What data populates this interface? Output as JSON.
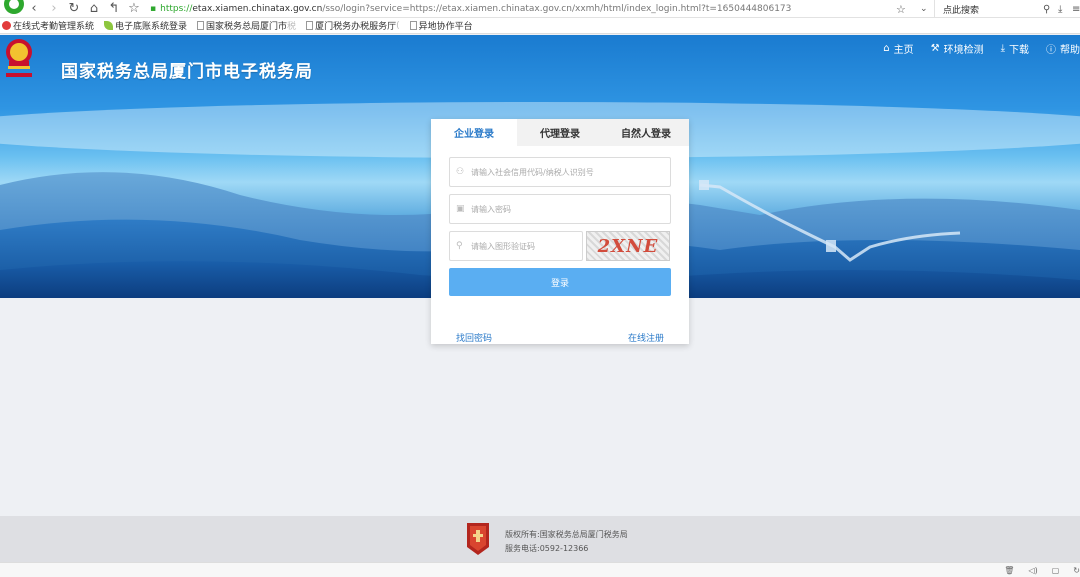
{
  "browser": {
    "url_prefix": "https://",
    "url_host": "etax.xiamen.chinatax.gov.cn",
    "url_rest": "/sso/login?service=https://etax.xiamen.chinatax.gov.cn/xxmh/html/index_login.html?t=1650444806173",
    "search_placeholder": "点此搜索"
  },
  "bookmarks": [
    {
      "label": "在线式考勤管理系统",
      "icon": "red"
    },
    {
      "label": "电子底账系统登录",
      "icon": "leaf"
    },
    {
      "label": "国家税务总局厦门市",
      "fade": "税",
      "icon": "page"
    },
    {
      "label": "厦门税务办税服务厅",
      "fade": "(",
      "icon": "page"
    },
    {
      "label": "异地协作平台",
      "icon": "page"
    }
  ],
  "header": {
    "title": "国家税务总局厦门市电子税务局",
    "nav": [
      {
        "label": "主页",
        "icon": "home-icon",
        "glyph": "⌂"
      },
      {
        "label": "环境检测",
        "icon": "wrench-icon",
        "glyph": "⚒"
      },
      {
        "label": "下载",
        "icon": "download-icon",
        "glyph": "⤓"
      },
      {
        "label": "帮助",
        "icon": "help-icon",
        "glyph": "?"
      }
    ]
  },
  "login": {
    "tabs": [
      {
        "label": "企业登录",
        "active": true
      },
      {
        "label": "代理登录",
        "active": false
      },
      {
        "label": "自然人登录",
        "active": false
      }
    ],
    "username_placeholder": "请输入社会信用代码/纳税人识别号",
    "password_placeholder": "请输入密码",
    "captcha_placeholder": "请输入图形验证码",
    "captcha_text": "2XNE",
    "submit_label": "登录",
    "forgot_label": "找回密码",
    "register_label": "在线注册"
  },
  "footer": {
    "copyright": "版权所有:国家税务总局厦门税务局",
    "phone": "服务电话:0592-12366"
  },
  "colors": {
    "accent": "#2a7ac9",
    "button": "#5aaef2",
    "captcha_text": "#d24c3c"
  }
}
